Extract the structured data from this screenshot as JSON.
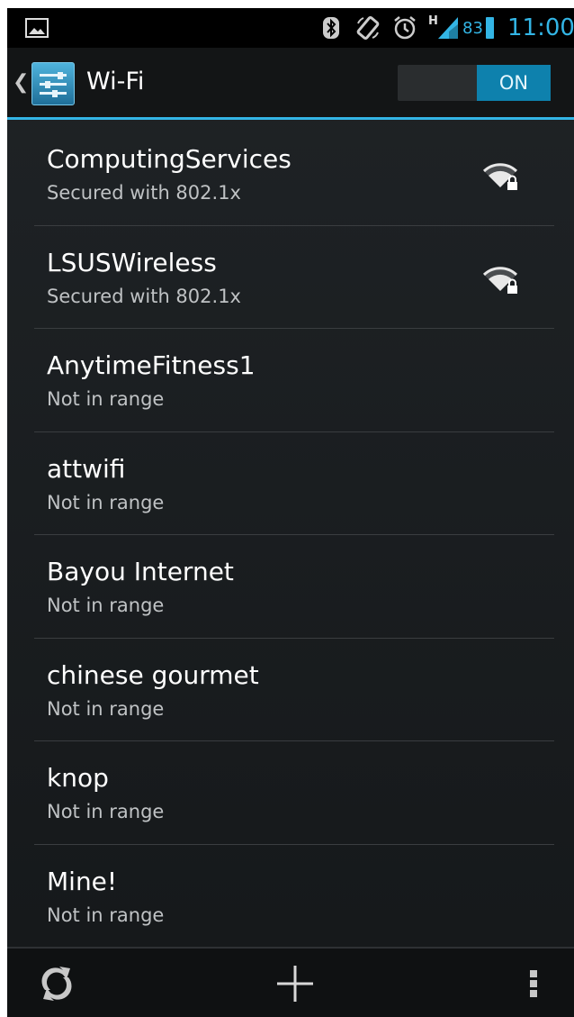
{
  "status_bar": {
    "signal_type": "H",
    "battery_percent": "83",
    "time": "11:00",
    "icons": [
      "gallery-icon",
      "bluetooth-icon",
      "rotate-icon",
      "alarm-icon",
      "signal-icon",
      "battery-icon"
    ],
    "accent_color": "#33b5e5"
  },
  "action_bar": {
    "title": "Wi-Fi",
    "toggle_label": "ON",
    "toggle_color": "#0e81ad",
    "divider_color": "#33b5e5"
  },
  "networks": [
    {
      "name": "ComputingServices",
      "status": "Secured with 802.1x",
      "signal_icon": "wifi-lock-icon"
    },
    {
      "name": "LSUSWireless",
      "status": "Secured with 802.1x",
      "signal_icon": "wifi-lock-icon"
    },
    {
      "name": "AnytimeFitness1",
      "status": "Not in range"
    },
    {
      "name": "attwifi",
      "status": "Not in range"
    },
    {
      "name": "Bayou Internet",
      "status": "Not in range"
    },
    {
      "name": "chinese gourmet",
      "status": "Not in range"
    },
    {
      "name": "knop",
      "status": "Not in range"
    },
    {
      "name": "Mine!",
      "status": "Not in range"
    }
  ],
  "bottom_bar": {
    "actions": [
      "scan-icon",
      "add-icon",
      "overflow-menu-icon"
    ]
  }
}
